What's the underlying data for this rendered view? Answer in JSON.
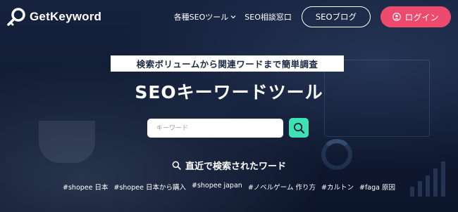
{
  "header": {
    "logo_text": "GetKeyword",
    "nav": [
      {
        "label": "各種SEOツール",
        "has_dropdown": true
      },
      {
        "label": "SEO相談窓口",
        "has_dropdown": false
      }
    ],
    "blog_button": "SEOブログ",
    "login_button": "ログイン"
  },
  "hero": {
    "tagline": "検索ボリュームから関連ワードまで簡単調査",
    "title": "SEOキーワードツール",
    "search": {
      "placeholder": "キーワード",
      "value": ""
    },
    "recent_heading": "直近で検索されたワード",
    "recent_tags": [
      "#shopee 日本",
      "#shopee 日本から購入",
      "#shopee japan",
      "#ノベルゲーム 作り方",
      "#カルトン",
      "#faga 原因"
    ]
  },
  "colors": {
    "accent_pink": "#ee4a6e",
    "accent_green": "#3ee0b4",
    "background_navy": "#101a32"
  },
  "icons": [
    "logo-key-magnifier-icon",
    "chevron-down-icon",
    "user-icon",
    "search-icon"
  ]
}
